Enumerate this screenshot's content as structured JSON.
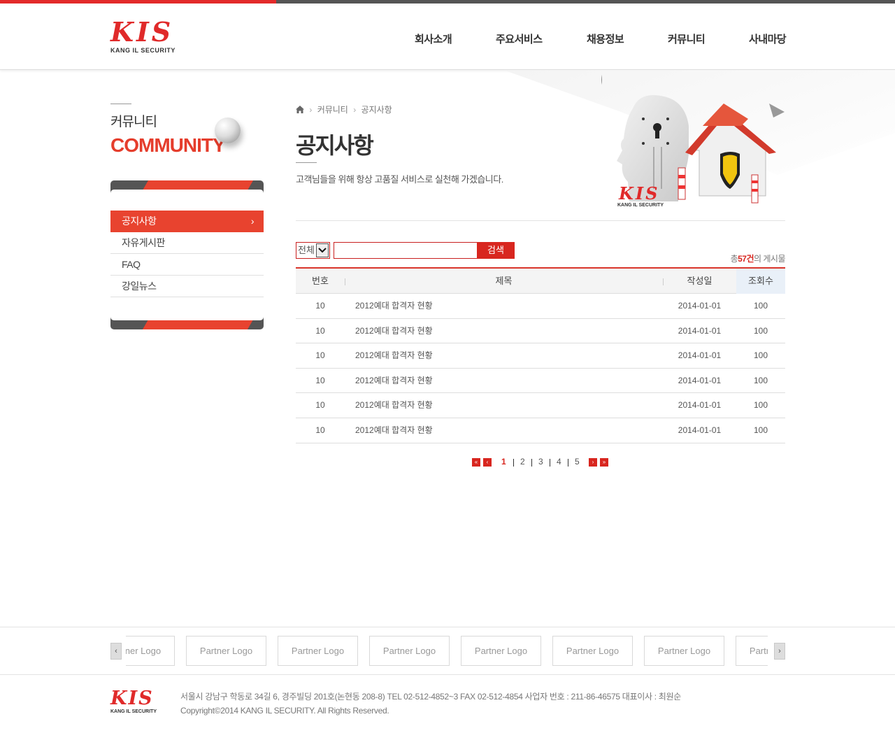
{
  "brand": {
    "name": "KIS",
    "sub": "KANG IL SECURITY",
    "primary_color": "#e32a2a",
    "accent_color": "#e8432f"
  },
  "nav": [
    {
      "label": "회사소개"
    },
    {
      "label": "주요서비스"
    },
    {
      "label": "채용정보"
    },
    {
      "label": "커뮤니티"
    },
    {
      "label": "사내마당"
    }
  ],
  "sidebar": {
    "title_ko": "커뮤니티",
    "title_en": "COMMUNITY",
    "items": [
      {
        "label": "공지사항",
        "active": true
      },
      {
        "label": "자유게시판"
      },
      {
        "label": "FAQ"
      },
      {
        "label": "강일뉴스"
      }
    ]
  },
  "breadcrumb": {
    "home_icon": "home-icon",
    "items": [
      "커뮤니티",
      "공지사항"
    ]
  },
  "page": {
    "title": "공지사항",
    "description": "고객님들을 위해 항상 고품질 서비스로 실천해 가겠습니다."
  },
  "search": {
    "select_value": "전체",
    "input_value": "",
    "button_label": "검색"
  },
  "total": {
    "prefix": "총",
    "count": "57건",
    "suffix": "의 게시물"
  },
  "table": {
    "columns": [
      "번호",
      "제목",
      "작성일",
      "조회수"
    ],
    "rows": [
      {
        "no": "10",
        "title": "2012예대 합격자 현황",
        "date": "2014-01-01",
        "views": "100"
      },
      {
        "no": "10",
        "title": "2012예대 합격자 현황",
        "date": "2014-01-01",
        "views": "100"
      },
      {
        "no": "10",
        "title": "2012예대 합격자 현황",
        "date": "2014-01-01",
        "views": "100"
      },
      {
        "no": "10",
        "title": "2012예대 합격자 현황",
        "date": "2014-01-01",
        "views": "100"
      },
      {
        "no": "10",
        "title": "2012예대 합격자 현황",
        "date": "2014-01-01",
        "views": "100"
      },
      {
        "no": "10",
        "title": "2012예대 합격자 현황",
        "date": "2014-01-01",
        "views": "100"
      }
    ]
  },
  "pagination": {
    "pages": [
      "1",
      "2",
      "3",
      "4",
      "5"
    ],
    "current": "1"
  },
  "partners": {
    "items": [
      "Partner Logo",
      "Partner Logo",
      "Partner Logo",
      "Partner Logo",
      "Partner Logo",
      "Partner Logo",
      "Partner Logo",
      "Partner Logo"
    ]
  },
  "footer": {
    "address": "서울시 강남구 학동로 34길 6, 경주빌딩 201호(논현동 208-8) TEL 02-512-4852~3 FAX 02-512-4854 사업자 번호 : 211-86-46575 대표이사 : 최원순",
    "copyright": "Copyright©2014 KANG IL SECURITY. All Rights Reserved."
  }
}
